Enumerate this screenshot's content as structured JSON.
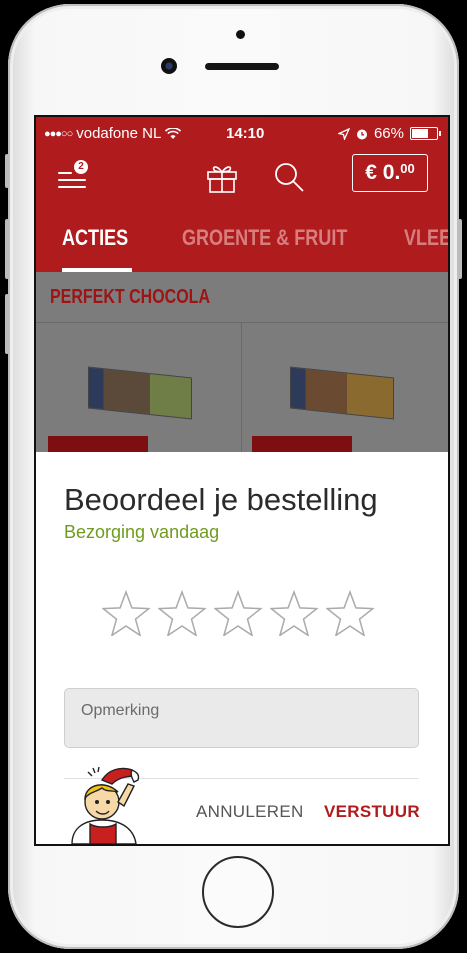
{
  "status_bar": {
    "signal_dots": "●●●○○",
    "carrier": "vodafone NL",
    "time": "14:10",
    "battery_percent": "66%",
    "battery_level": 0.66
  },
  "toolbar": {
    "menu_badge": "2",
    "cart_currency": "€ 0.",
    "cart_cents": "00"
  },
  "tabs": [
    {
      "label": "ACTIES",
      "active": true
    },
    {
      "label": "GROENTE & FRUIT",
      "active": false
    },
    {
      "label": "VLEES",
      "active": false
    }
  ],
  "content": {
    "section_title": "PERFEKT CHOCOLA"
  },
  "rating_sheet": {
    "title": "Beoordeel je bestelling",
    "subtitle": "Bezorging vandaag",
    "stars_total": 5,
    "stars_selected": 0,
    "remark_placeholder": "Opmerking",
    "cancel_label": "ANNULEREN",
    "submit_label": "VERSTUUR"
  },
  "colors": {
    "brand_red": "#b01c1e",
    "subtitle_green": "#6f9b1e"
  }
}
